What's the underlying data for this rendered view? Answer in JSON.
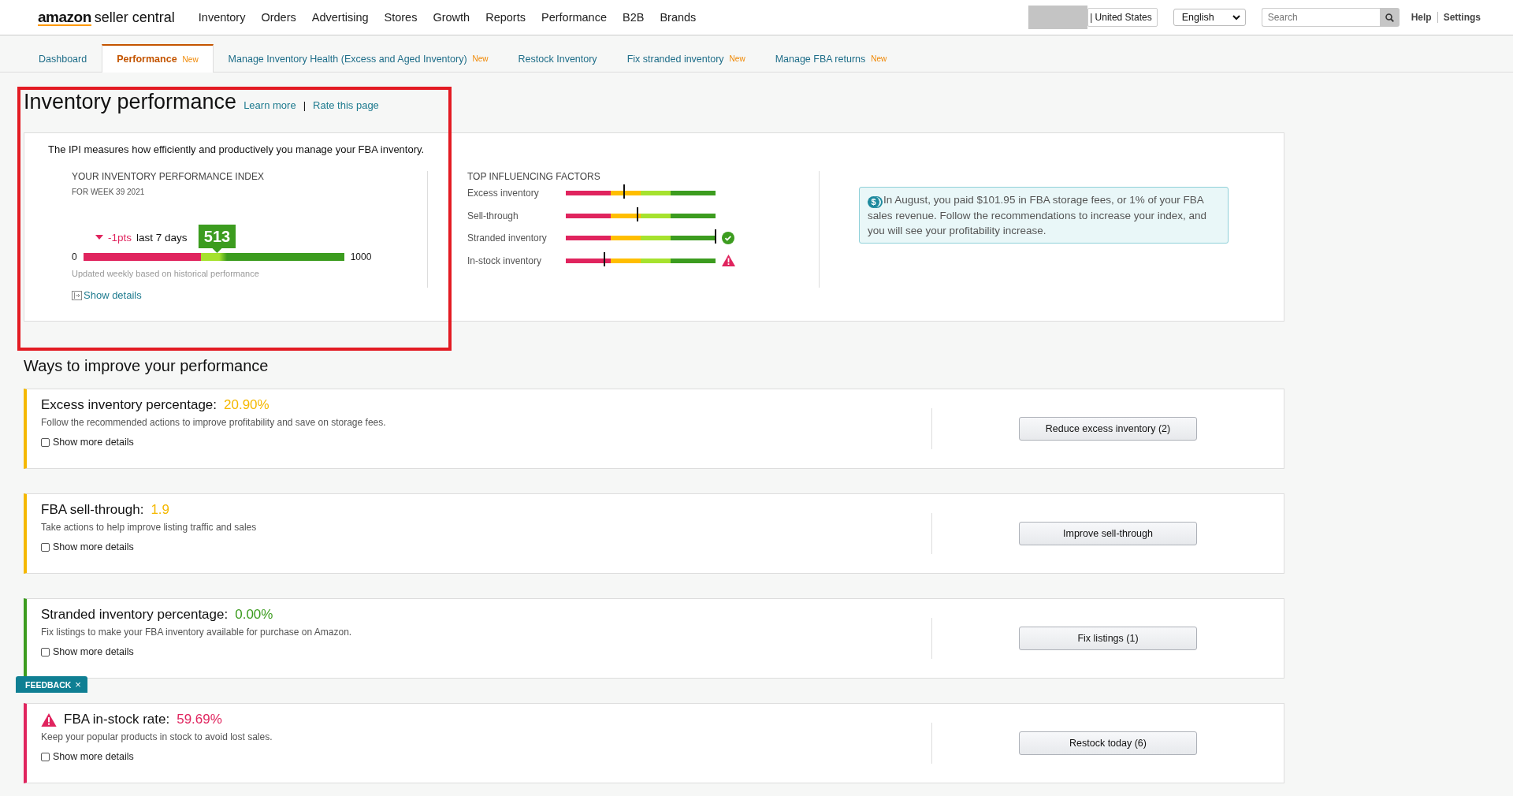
{
  "top_bar": {
    "logo": {
      "brand": "amazon",
      "product": "seller central"
    },
    "nav": [
      "Inventory",
      "Orders",
      "Advertising",
      "Stores",
      "Growth",
      "Reports",
      "Performance",
      "B2B",
      "Brands"
    ],
    "marketplace": "| United States",
    "language": "English",
    "search": {
      "placeholder": "Search"
    },
    "links": [
      "Help",
      "Settings"
    ]
  },
  "tabs": [
    {
      "label": "Dashboard",
      "selected": false
    },
    {
      "label": "Performance",
      "badge": "New",
      "selected": true
    },
    {
      "label": "Manage Inventory Health (Excess and Aged Inventory)",
      "badge": "New",
      "selected": false
    },
    {
      "label": "Restock Inventory",
      "selected": false
    },
    {
      "label": "Fix stranded inventory",
      "badge": "New",
      "selected": false
    },
    {
      "label": "Manage FBA returns",
      "badge": "New",
      "selected": false
    }
  ],
  "header": {
    "title": "Inventory performance",
    "links": [
      "Learn more",
      "Rate this page"
    ],
    "separator": "|"
  },
  "ipi_card": {
    "intro": "The IPI measures how efficiently and productively you manage your FBA inventory.",
    "index": {
      "title": "YOUR INVENTORY PERFORMANCE INDEX",
      "week": "FOR WEEK 39 2021",
      "change": "-1pts",
      "change_period": "last 7 days",
      "score": "513",
      "level": 0.513,
      "min": "0",
      "max": "1000",
      "note": "Updated weekly based on historical performance",
      "details_link": "Show details"
    },
    "factors": {
      "title": "TOP INFLUENCING FACTORS",
      "items": [
        {
          "label": "Excess inventory",
          "level": 0.39,
          "kind": "plain"
        },
        {
          "label": "Sell-through",
          "level": 0.48,
          "kind": "plain"
        },
        {
          "label": "Stranded inventory",
          "level": 1.0,
          "kind": "ok"
        },
        {
          "label": "In-stock inventory",
          "level": 0.26,
          "kind": "warning"
        }
      ]
    },
    "info_icon": "$",
    "info": "In August, you paid $101.95 in FBA storage fees, or 1% of your FBA sales revenue. Follow the recommendations to increase your index, and you will see your profitability increase."
  },
  "improve": {
    "title": "Ways to improve your performance",
    "sections": [
      {
        "label": "Excess inventory percentage:",
        "value": "20.90%",
        "color": "#f5b800",
        "warning": false,
        "description": "Follow the recommended actions to improve profitability and save on storage fees.",
        "details": "Show more details",
        "checked": false,
        "action": "Reduce excess inventory (2)"
      },
      {
        "label": "FBA sell-through:",
        "value": "1.9",
        "color": "#f5b800",
        "warning": false,
        "description": "Take actions to help improve listing traffic and sales",
        "details": "Show more details",
        "checked": false,
        "action": "Improve sell-through"
      },
      {
        "label": "Stranded inventory percentage:",
        "value": "0.00%",
        "color": "#3c9c1f",
        "warning": false,
        "description": "Fix listings to make your FBA inventory available for purchase on Amazon.",
        "details": "Show more details",
        "checked": false,
        "action": "Fix listings (1)"
      },
      {
        "label": "FBA in-stock rate:",
        "value": "59.69%",
        "color": "#e0245e",
        "warning": true,
        "description": "Keep your popular products in stock to avoid lost sales.",
        "details": "Show more details",
        "checked": false,
        "action": "Restock today (6)"
      }
    ]
  },
  "feedback": {
    "label": "FEEDBACK",
    "close": "×"
  }
}
